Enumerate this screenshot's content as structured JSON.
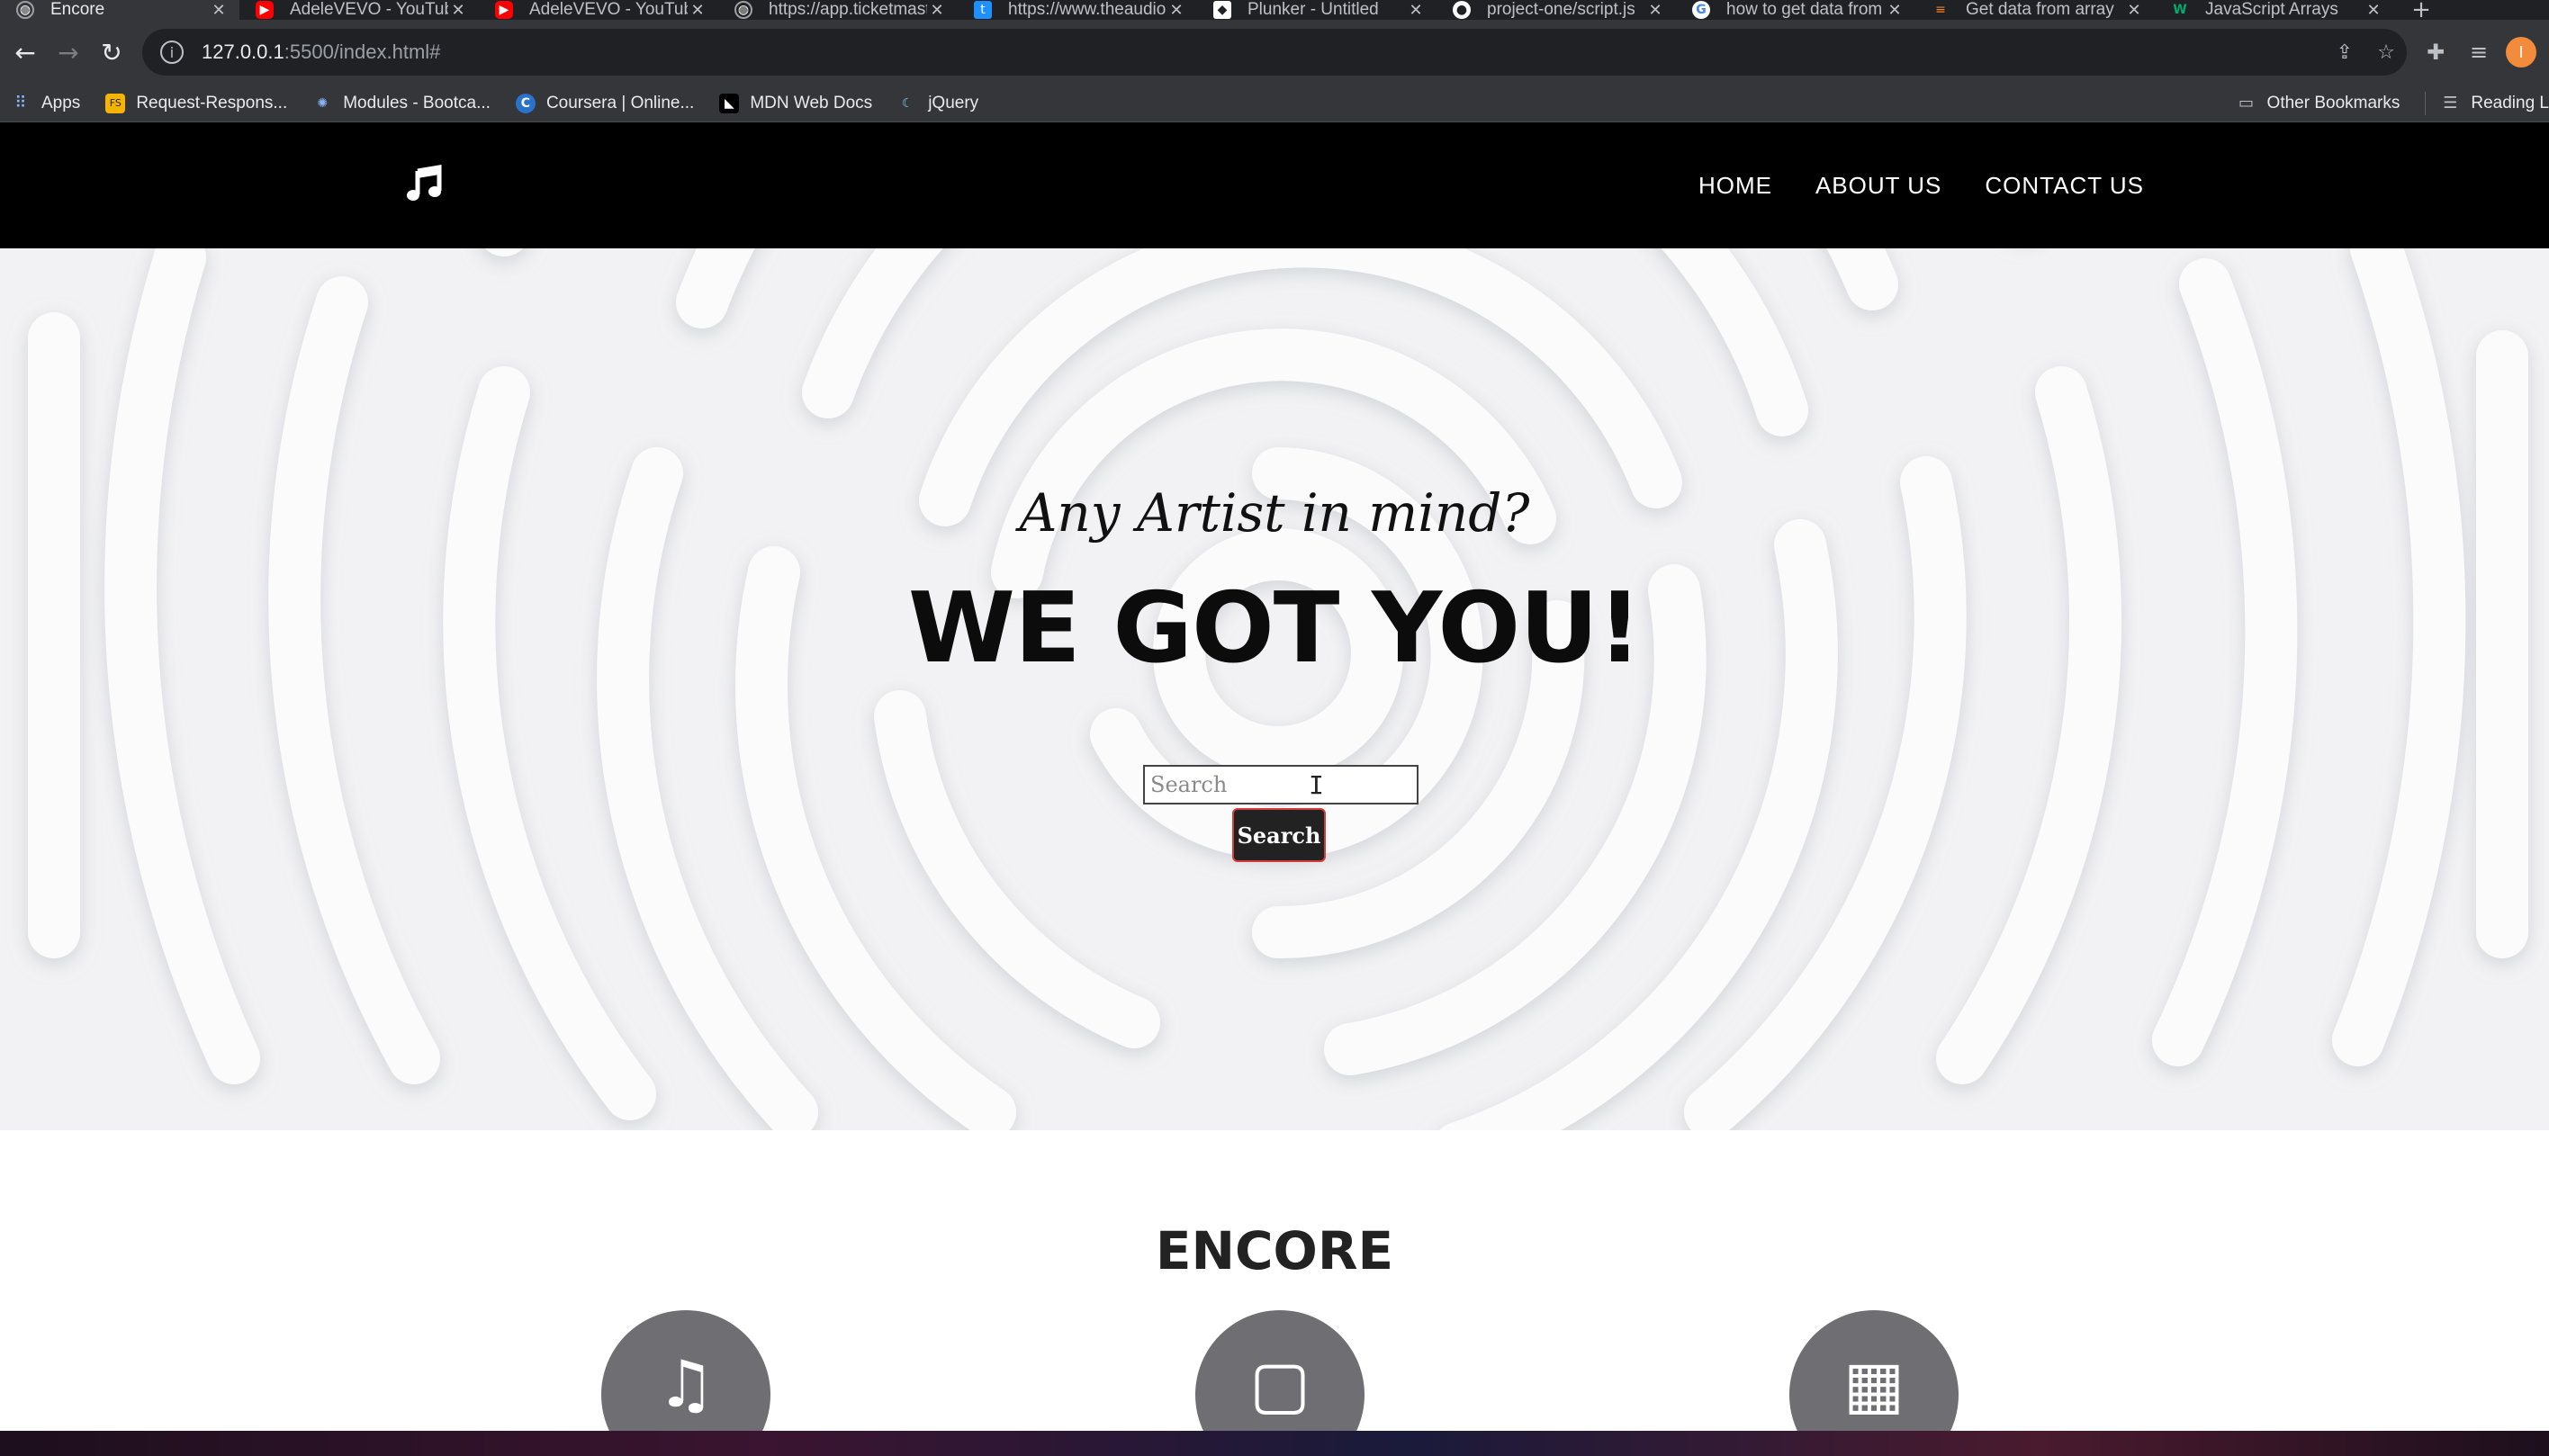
{
  "browser": {
    "tabs": [
      {
        "title": "Encore",
        "icon": "globe-icon",
        "color": "#5f6368",
        "active": true
      },
      {
        "title": "AdeleVEVO - YouTube",
        "icon": "youtube-icon",
        "color": "#ff0000",
        "active": false
      },
      {
        "title": "AdeleVEVO - YouTube",
        "icon": "youtube-icon",
        "color": "#ff0000",
        "active": false
      },
      {
        "title": "https://app.ticketmaster",
        "icon": "globe-icon",
        "color": "#5f6368",
        "active": false
      },
      {
        "title": "https://www.theaudiodb",
        "icon": "tadb-icon",
        "color": "#1e90ff",
        "active": false
      },
      {
        "title": "Plunker - Untitled",
        "icon": "plunker-icon",
        "color": "#ffffff",
        "active": false
      },
      {
        "title": "project-one/script.js",
        "icon": "github-icon",
        "color": "#ffffff",
        "active": false
      },
      {
        "title": "how to get data from",
        "icon": "google-icon",
        "color": "#4285f4",
        "active": false
      },
      {
        "title": "Get data from array",
        "icon": "stackoverflow-icon",
        "color": "#f48024",
        "active": false
      },
      {
        "title": "JavaScript Arrays",
        "icon": "w3schools-icon",
        "color": "#04aa6d",
        "active": false
      }
    ],
    "url_host": "127.0.0.1",
    "url_path": ":5500/index.html#",
    "profile_initial": "I",
    "bookmarks": [
      {
        "label": "Apps",
        "icon": "apps-grid-icon",
        "color": "#4285f4"
      },
      {
        "label": "Request-Respons...",
        "icon": "request-icon",
        "color": "#f4b400"
      },
      {
        "label": "Modules - Bootca...",
        "icon": "modules-icon",
        "color": "#5b6cff"
      },
      {
        "label": "Coursera | Online...",
        "icon": "coursera-icon",
        "color": "#2a73cc"
      },
      {
        "label": "MDN Web Docs",
        "icon": "mdn-icon",
        "color": "#000000"
      },
      {
        "label": "jQuery",
        "icon": "jquery-icon",
        "color": "#0769ad"
      }
    ],
    "other_bookmarks": "Other Bookmarks",
    "reading_list": "Reading L"
  },
  "site": {
    "nav": [
      {
        "label": "HOME"
      },
      {
        "label": "ABOUT US"
      },
      {
        "label": "CONTACT US"
      }
    ],
    "hero": {
      "subtitle": "Any Artist in mind?",
      "title": "WE GOT YOU!",
      "search_placeholder": "Search",
      "search_button": "Search"
    },
    "about": {
      "heading": "ENCORE",
      "features": [
        {
          "icon": "music-note-icon"
        },
        {
          "icon": "monitor-icon"
        },
        {
          "icon": "calendar-icon"
        }
      ]
    }
  }
}
